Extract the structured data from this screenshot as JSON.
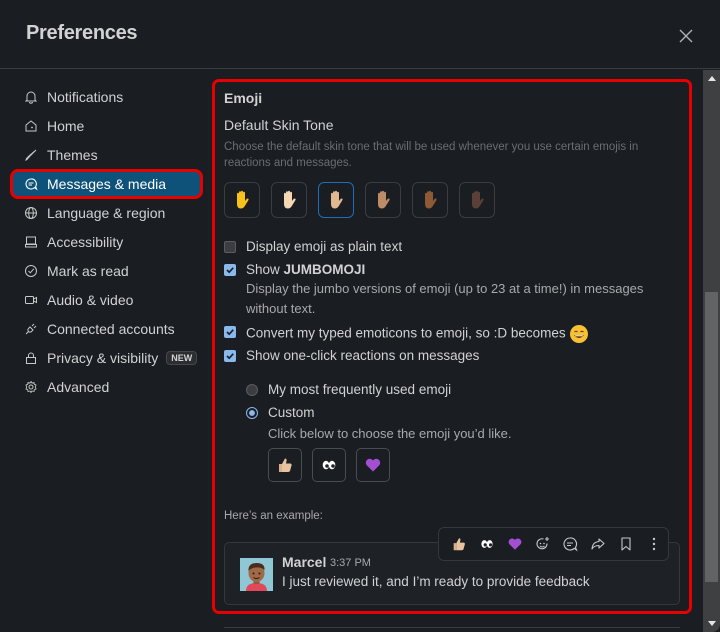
{
  "header": {
    "title": "Preferences",
    "close_icon": "close-icon"
  },
  "sidebar": {
    "items": [
      {
        "label": "Notifications",
        "icon": "bell-icon"
      },
      {
        "label": "Home",
        "icon": "home-icon"
      },
      {
        "label": "Themes",
        "icon": "brush-icon"
      },
      {
        "label": "Messages & media",
        "icon": "message-icon",
        "active": true
      },
      {
        "label": "Language & region",
        "icon": "globe-icon"
      },
      {
        "label": "Accessibility",
        "icon": "laptop-icon"
      },
      {
        "label": "Mark as read",
        "icon": "check-circle-icon"
      },
      {
        "label": "Audio & video",
        "icon": "video-icon"
      },
      {
        "label": "Connected accounts",
        "icon": "plug-icon"
      },
      {
        "label": "Privacy & visibility",
        "icon": "lock-icon",
        "badge": "NEW"
      },
      {
        "label": "Advanced",
        "icon": "gear-icon"
      }
    ]
  },
  "emoji": {
    "section_title": "Emoji",
    "skin_tone_title": "Default Skin Tone",
    "skin_tone_desc": "Choose the default skin tone that will be used whenever you use certain emojis in reactions and messages.",
    "skin_tones": [
      {
        "name": "default",
        "color": "#f8c21c",
        "selected": false
      },
      {
        "name": "light",
        "color": "#f5d6b5",
        "selected": false
      },
      {
        "name": "medium-light",
        "color": "#e0b990",
        "selected": true
      },
      {
        "name": "medium",
        "color": "#bb8c66",
        "selected": false
      },
      {
        "name": "medium-dark",
        "color": "#8e5a36",
        "selected": false
      },
      {
        "name": "dark",
        "color": "#5a4038",
        "selected": false
      }
    ],
    "options": {
      "plain_text": {
        "label": "Display emoji as plain text",
        "checked": false
      },
      "jumbomoji": {
        "label_prefix": "Show ",
        "label_bold": "JUMBOMOJI",
        "checked": true,
        "desc": "Display the jumbo versions of emoji (up to 23 at a time!) in messages without text."
      },
      "convert": {
        "label": "Convert my typed emoticons to emoji, so :D becomes",
        "checked": true
      },
      "one_click": {
        "label": "Show one-click reactions on messages",
        "checked": true
      }
    },
    "reaction_mode": {
      "frequent": {
        "label": "My most frequently used emoji",
        "selected": false
      },
      "custom": {
        "label": "Custom",
        "selected": true,
        "desc": "Click below to choose the emoji you’d like."
      }
    },
    "custom_emojis": [
      "thumbs-up",
      "eyes",
      "purple-heart"
    ],
    "example_label": "Here’s an example:",
    "example_message": {
      "author": "Marcel",
      "time": "3:37 PM",
      "text": "I just reviewed it, and I’m ready to provide feedback"
    },
    "hover_actions": [
      "thumbs-up",
      "eyes",
      "purple-heart",
      "add-reaction",
      "reply-in-thread",
      "share",
      "save",
      "more-actions"
    ]
  },
  "colors": {
    "accent_active": "#0f5279",
    "highlight_outline": "#e60000",
    "checkbox": "#8ab8ec"
  }
}
